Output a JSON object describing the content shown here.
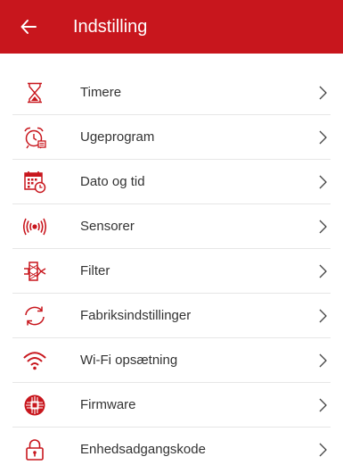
{
  "colors": {
    "accent": "#c8161d",
    "text": "#333333",
    "divider": "#e6e6e6"
  },
  "header": {
    "title": "Indstilling",
    "back_icon": "arrow-left-icon"
  },
  "items": [
    {
      "label": "Timere",
      "icon": "hourglass-icon"
    },
    {
      "label": "Ugeprogram",
      "icon": "alarm-clock-icon"
    },
    {
      "label": "Dato og tid",
      "icon": "calendar-clock-icon"
    },
    {
      "label": "Sensorer",
      "icon": "sensor-waves-icon"
    },
    {
      "label": "Filter",
      "icon": "filter-icon"
    },
    {
      "label": "Fabriksindstillinger",
      "icon": "reset-arrows-icon"
    },
    {
      "label": "Wi-Fi opsætning",
      "icon": "wifi-icon"
    },
    {
      "label": "Firmware",
      "icon": "chip-icon"
    },
    {
      "label": "Enhedsadgangskode",
      "icon": "lock-icon"
    }
  ]
}
